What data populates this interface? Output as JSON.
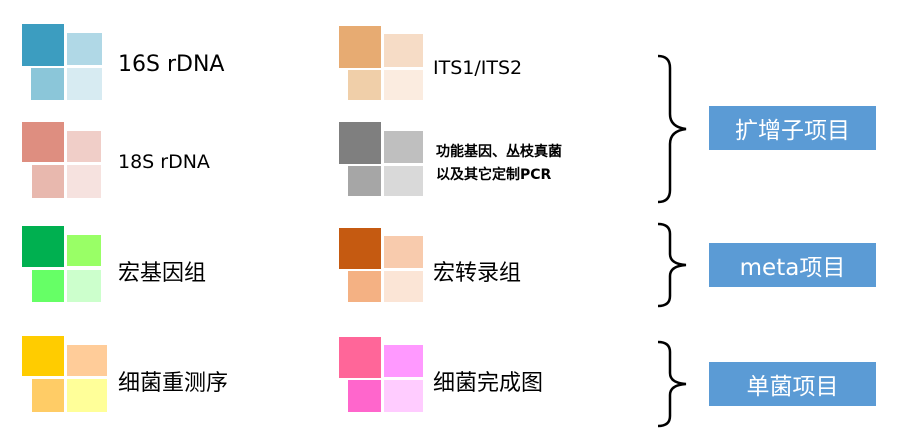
{
  "items": [
    {
      "label": "16S rDNA",
      "colors": [
        "#3c9dc0",
        "#b0d8e6",
        "#8bc6d9",
        "#d7ebf2"
      ]
    },
    {
      "label": "ITS1/ITS2",
      "colors": [
        "#e7ab72",
        "#f6dcc6",
        "#f0cfa9",
        "#fbece0"
      ]
    },
    {
      "label": "18S rDNA",
      "colors": [
        "#de8e80",
        "#f0cec8",
        "#e8b8ae",
        "#f6e2df"
      ]
    },
    {
      "label_line1": "功能基因、丛枝真菌",
      "label_line2": "以及其它定制PCR",
      "colors": [
        "#7f7f7f",
        "#bfbfbf",
        "#a6a6a6",
        "#d9d9d9"
      ]
    },
    {
      "label": "宏基因组",
      "colors": [
        "#00b050",
        "#99ff66",
        "#66ff66",
        "#ccffcc"
      ]
    },
    {
      "label": "宏转录组",
      "colors": [
        "#c55a11",
        "#f8cbad",
        "#f4b183",
        "#fbe5d6"
      ]
    },
    {
      "label": "细菌重测序",
      "colors": [
        "#ffcc00",
        "#ffcc99",
        "#ffcc66",
        "#ffff99"
      ]
    },
    {
      "label": "细菌完成图",
      "colors": [
        "#ff6699",
        "#ff99ff",
        "#ff66cc",
        "#ffccff"
      ]
    }
  ],
  "groups": [
    {
      "label": "扩增子项目",
      "color": "#5b9bd5"
    },
    {
      "label": "meta项目",
      "color": "#5b9bd5"
    },
    {
      "label": "单菌项目",
      "color": "#5b9bd5"
    }
  ]
}
